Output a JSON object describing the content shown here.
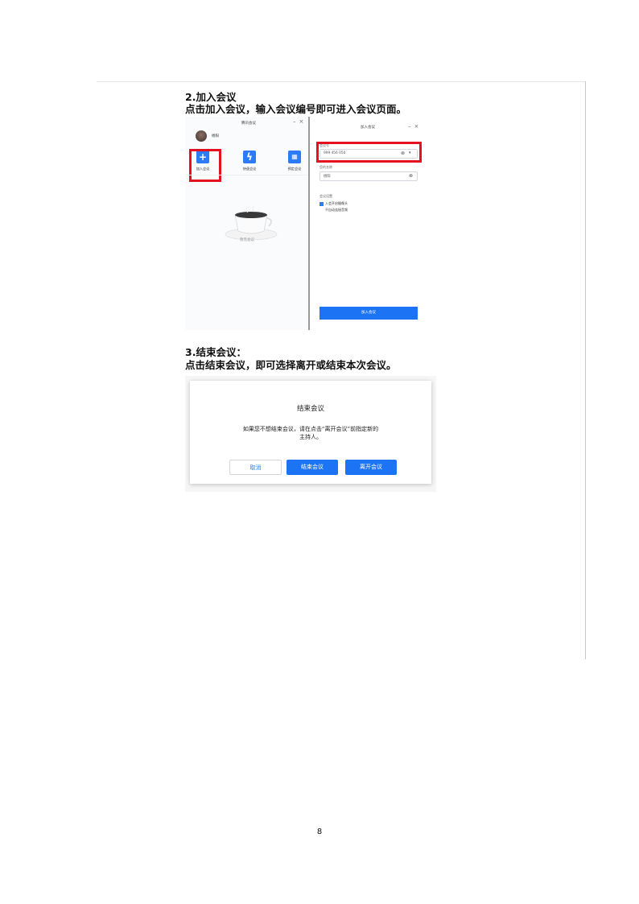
{
  "section2": {
    "heading": "2.加入会议",
    "instruction": "点击加入会议，输入会议编号即可进入会议页面。"
  },
  "screenshot_join": {
    "left_window": {
      "title": "腾讯会议",
      "user_name": "杨阳",
      "actions": [
        {
          "label": "加入会议",
          "icon": "plus-icon"
        },
        {
          "label": "快速会议",
          "icon": "lightning-icon"
        },
        {
          "label": "预定会议",
          "icon": "calendar-icon"
        }
      ],
      "empty_state": "暂无会议"
    },
    "right_window": {
      "title": "加入会议",
      "meeting_id_label": "会议号",
      "meeting_id_value": "999 456 050",
      "name_label": "您的名称",
      "name_value": "杨阳",
      "settings_label": "会议设置",
      "option_1": "入会开启摄像头",
      "option_1_checked": true,
      "option_2": "不自动连接音频",
      "option_2_checked": false,
      "join_button": "加入会议"
    }
  },
  "section3": {
    "heading": "3.结束会议：",
    "instruction": "点击结束会议，即可选择离开或结束本次会议。"
  },
  "dialog": {
    "title": "结束会议",
    "message_line1": "如果您不想结束会议，请在点击“离开会议”前指定新的",
    "message_line2": "主持人。",
    "cancel": "取消",
    "end": "结束会议",
    "leave": "离开会议"
  },
  "page_number": "8",
  "colors": {
    "accent": "#1c74f5",
    "highlight": "#e3121c"
  }
}
